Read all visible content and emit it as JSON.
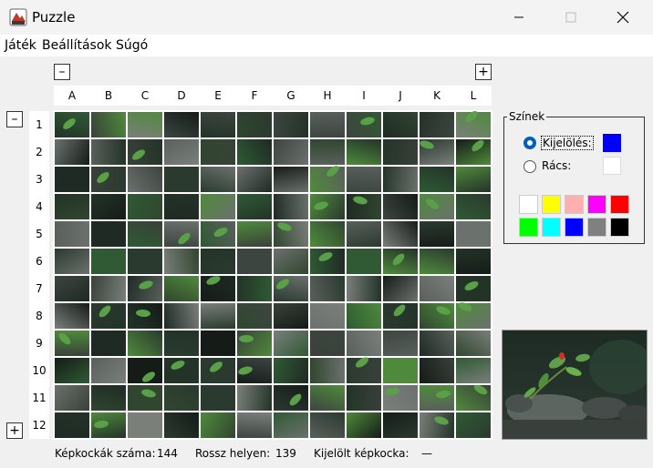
{
  "window": {
    "title": "Puzzle"
  },
  "menu": {
    "game": "Játék",
    "settings": "Beállítások",
    "help": "Súgó"
  },
  "board": {
    "zoom_out_label": "–",
    "zoom_in_label": "+",
    "columns": [
      "A",
      "B",
      "C",
      "D",
      "E",
      "F",
      "G",
      "H",
      "I",
      "J",
      "K",
      "L"
    ],
    "rows": [
      "1",
      "2",
      "3",
      "4",
      "5",
      "6",
      "7",
      "8",
      "9",
      "10",
      "11",
      "12"
    ],
    "row_minus_label": "–",
    "row_plus_label": "+"
  },
  "status": {
    "pieces_label": "Képkockák száma:",
    "pieces_value": "144",
    "wrong_label": "Rossz helyen:",
    "wrong_value": "139",
    "selected_label": "Kijelölt képkocka:",
    "selected_value": "—"
  },
  "colors_panel": {
    "legend": "Színek",
    "selection_label": "Kijelölés:",
    "grid_label": "Rács:",
    "selection_color": "#0000ff",
    "grid_color": "#ffffff",
    "palette": [
      "#ffffff",
      "#ffff00",
      "#ffafaf",
      "#ff00ff",
      "#ff0000",
      "#00ff00",
      "#00ffff",
      "#0000ff",
      "#808080",
      "#000000"
    ]
  }
}
